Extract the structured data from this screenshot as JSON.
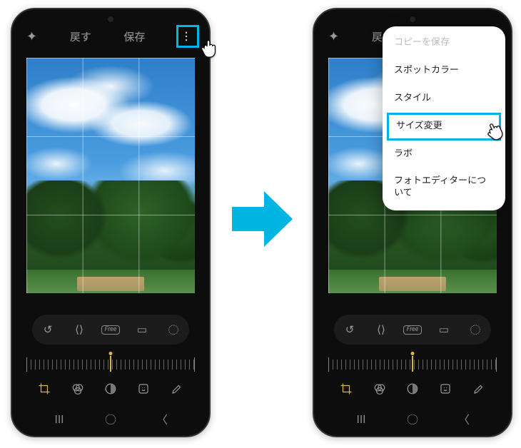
{
  "topbar": {
    "back_label": "戻す",
    "save_label": "保存"
  },
  "tools": {
    "free_label": "Free"
  },
  "menu": {
    "items": [
      {
        "label": "コピーを保存",
        "disabled": true
      },
      {
        "label": "スポットカラー"
      },
      {
        "label": "スタイル"
      },
      {
        "label": "サイズ変更",
        "highlight": true
      },
      {
        "label": "ラボ"
      },
      {
        "label": "フォトエディターについて"
      }
    ]
  }
}
